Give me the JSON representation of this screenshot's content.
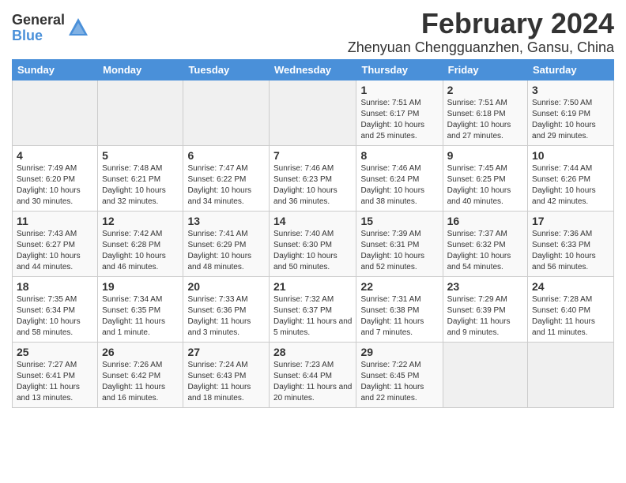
{
  "logo": {
    "general": "General",
    "blue": "Blue"
  },
  "title": "February 2024",
  "subtitle": "Zhenyuan Chengguanzhen, Gansu, China",
  "days_of_week": [
    "Sunday",
    "Monday",
    "Tuesday",
    "Wednesday",
    "Thursday",
    "Friday",
    "Saturday"
  ],
  "weeks": [
    [
      {
        "day": "",
        "empty": true
      },
      {
        "day": "",
        "empty": true
      },
      {
        "day": "",
        "empty": true
      },
      {
        "day": "",
        "empty": true
      },
      {
        "day": "1",
        "sunrise": "7:51 AM",
        "sunset": "6:17 PM",
        "daylight": "10 hours and 25 minutes."
      },
      {
        "day": "2",
        "sunrise": "7:51 AM",
        "sunset": "6:18 PM",
        "daylight": "10 hours and 27 minutes."
      },
      {
        "day": "3",
        "sunrise": "7:50 AM",
        "sunset": "6:19 PM",
        "daylight": "10 hours and 29 minutes."
      }
    ],
    [
      {
        "day": "4",
        "sunrise": "7:49 AM",
        "sunset": "6:20 PM",
        "daylight": "10 hours and 30 minutes."
      },
      {
        "day": "5",
        "sunrise": "7:48 AM",
        "sunset": "6:21 PM",
        "daylight": "10 hours and 32 minutes."
      },
      {
        "day": "6",
        "sunrise": "7:47 AM",
        "sunset": "6:22 PM",
        "daylight": "10 hours and 34 minutes."
      },
      {
        "day": "7",
        "sunrise": "7:46 AM",
        "sunset": "6:23 PM",
        "daylight": "10 hours and 36 minutes."
      },
      {
        "day": "8",
        "sunrise": "7:46 AM",
        "sunset": "6:24 PM",
        "daylight": "10 hours and 38 minutes."
      },
      {
        "day": "9",
        "sunrise": "7:45 AM",
        "sunset": "6:25 PM",
        "daylight": "10 hours and 40 minutes."
      },
      {
        "day": "10",
        "sunrise": "7:44 AM",
        "sunset": "6:26 PM",
        "daylight": "10 hours and 42 minutes."
      }
    ],
    [
      {
        "day": "11",
        "sunrise": "7:43 AM",
        "sunset": "6:27 PM",
        "daylight": "10 hours and 44 minutes."
      },
      {
        "day": "12",
        "sunrise": "7:42 AM",
        "sunset": "6:28 PM",
        "daylight": "10 hours and 46 minutes."
      },
      {
        "day": "13",
        "sunrise": "7:41 AM",
        "sunset": "6:29 PM",
        "daylight": "10 hours and 48 minutes."
      },
      {
        "day": "14",
        "sunrise": "7:40 AM",
        "sunset": "6:30 PM",
        "daylight": "10 hours and 50 minutes."
      },
      {
        "day": "15",
        "sunrise": "7:39 AM",
        "sunset": "6:31 PM",
        "daylight": "10 hours and 52 minutes."
      },
      {
        "day": "16",
        "sunrise": "7:37 AM",
        "sunset": "6:32 PM",
        "daylight": "10 hours and 54 minutes."
      },
      {
        "day": "17",
        "sunrise": "7:36 AM",
        "sunset": "6:33 PM",
        "daylight": "10 hours and 56 minutes."
      }
    ],
    [
      {
        "day": "18",
        "sunrise": "7:35 AM",
        "sunset": "6:34 PM",
        "daylight": "10 hours and 58 minutes."
      },
      {
        "day": "19",
        "sunrise": "7:34 AM",
        "sunset": "6:35 PM",
        "daylight": "11 hours and 1 minute."
      },
      {
        "day": "20",
        "sunrise": "7:33 AM",
        "sunset": "6:36 PM",
        "daylight": "11 hours and 3 minutes."
      },
      {
        "day": "21",
        "sunrise": "7:32 AM",
        "sunset": "6:37 PM",
        "daylight": "11 hours and 5 minutes."
      },
      {
        "day": "22",
        "sunrise": "7:31 AM",
        "sunset": "6:38 PM",
        "daylight": "11 hours and 7 minutes."
      },
      {
        "day": "23",
        "sunrise": "7:29 AM",
        "sunset": "6:39 PM",
        "daylight": "11 hours and 9 minutes."
      },
      {
        "day": "24",
        "sunrise": "7:28 AM",
        "sunset": "6:40 PM",
        "daylight": "11 hours and 11 minutes."
      }
    ],
    [
      {
        "day": "25",
        "sunrise": "7:27 AM",
        "sunset": "6:41 PM",
        "daylight": "11 hours and 13 minutes."
      },
      {
        "day": "26",
        "sunrise": "7:26 AM",
        "sunset": "6:42 PM",
        "daylight": "11 hours and 16 minutes."
      },
      {
        "day": "27",
        "sunrise": "7:24 AM",
        "sunset": "6:43 PM",
        "daylight": "11 hours and 18 minutes."
      },
      {
        "day": "28",
        "sunrise": "7:23 AM",
        "sunset": "6:44 PM",
        "daylight": "11 hours and 20 minutes."
      },
      {
        "day": "29",
        "sunrise": "7:22 AM",
        "sunset": "6:45 PM",
        "daylight": "11 hours and 22 minutes."
      },
      {
        "day": "",
        "empty": true
      },
      {
        "day": "",
        "empty": true
      }
    ]
  ]
}
